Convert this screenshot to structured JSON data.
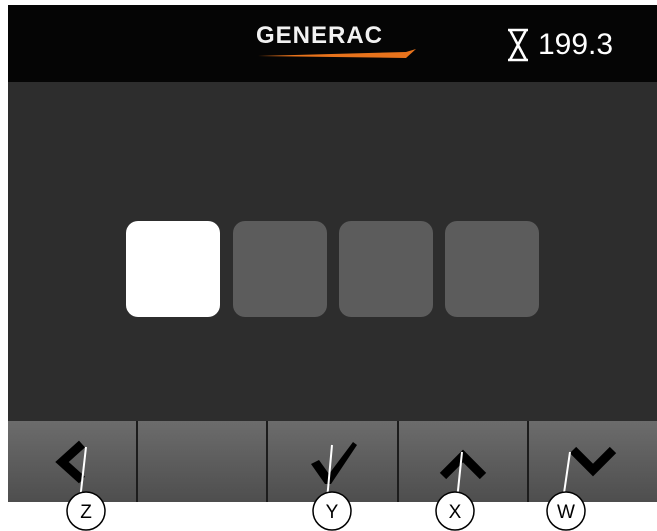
{
  "header": {
    "brand": "GENERAC",
    "brand_mark": ".",
    "brand_accent_color": "#e8731c",
    "timer_icon": "hourglass-icon",
    "timer_value": "199.3"
  },
  "pin_entry": {
    "box_count": 4,
    "active_index": 0,
    "active_color": "#ffffff",
    "inactive_color": "#5c5c5c"
  },
  "softkeys": [
    {
      "id": "Z",
      "icon": "chevron-left-icon"
    },
    {
      "id": "",
      "icon": ""
    },
    {
      "id": "Y",
      "icon": "checkmark-icon"
    },
    {
      "id": "X",
      "icon": "chevron-up-icon"
    },
    {
      "id": "W",
      "icon": "chevron-down-icon"
    }
  ],
  "callouts": {
    "z": "Z",
    "y": "Y",
    "x": "X",
    "w": "W"
  }
}
